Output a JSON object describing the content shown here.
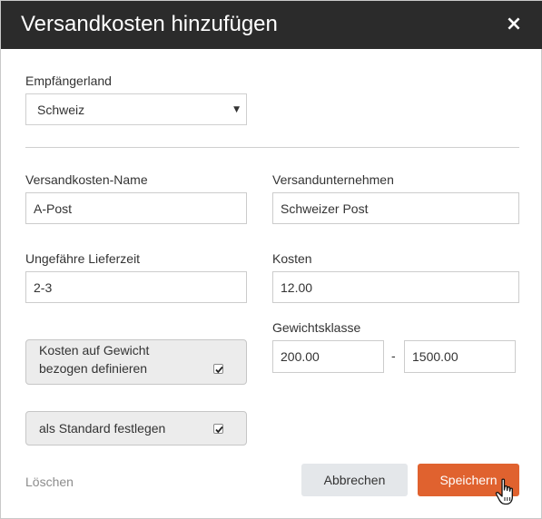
{
  "dialog": {
    "title": "Versandkosten hinzufügen",
    "close_glyph": "×"
  },
  "country": {
    "label": "Empfängerland",
    "value": "Schweiz",
    "arrow_glyph": "▼"
  },
  "shipping_name": {
    "label": "Versandkosten-Name",
    "value": "A-Post"
  },
  "carrier": {
    "label": "Versandunternehmen",
    "value": "Schweizer Post"
  },
  "delivery_time": {
    "label": "Ungefähre Lieferzeit",
    "value": "2-3"
  },
  "cost": {
    "label": "Kosten",
    "value": "12.00"
  },
  "weight_class": {
    "label": "Gewichtsklasse",
    "from": "200.00",
    "separator": "-",
    "to": "1500.00"
  },
  "weight_based": {
    "label_line1": "Kosten auf Gewicht",
    "label_line2": "bezogen definieren",
    "checked": true
  },
  "set_default": {
    "label": "als Standard festlegen",
    "checked": true
  },
  "actions": {
    "delete": "Löschen",
    "cancel": "Abbrechen",
    "save": "Speichern"
  },
  "colors": {
    "titlebar": "#2b2b2b",
    "save_button": "#e0622f",
    "cancel_button": "#e4e7ea"
  },
  "icons": {
    "close": "close-icon",
    "dropdown": "chevron-down-icon",
    "check": "checkmark-icon",
    "cursor": "hand-pointer-icon"
  }
}
